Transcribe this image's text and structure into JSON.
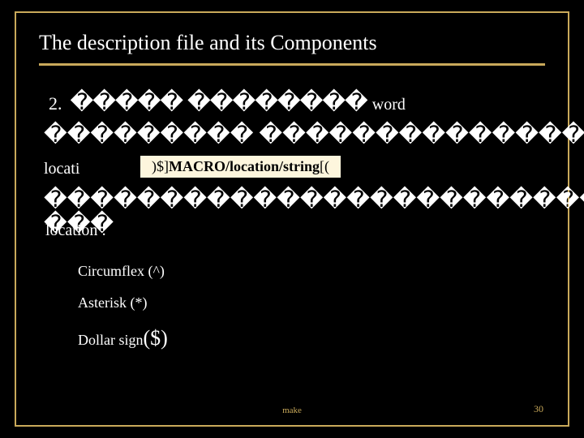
{
  "title": "The description file and its Components",
  "item_number": "2.",
  "boxes_a": "����� ��������",
  "word_label": "word",
  "boxes_row2": "��������� ���������������������������",
  "location_text": "locati",
  "callout_plain1": ")$]",
  "callout_bold": "MACRO/location/string",
  "callout_plain2": "[(",
  "boxes_row3": "����������������������������������",
  "boxes_row3b": "���",
  "overlap_text": "location :",
  "list": {
    "circumflex": "Circumflex (^)",
    "asterisk": "Asterisk (*)",
    "dollar_prefix": "Dollar sign",
    "dollar_symbol": "($)"
  },
  "footer_tool": "make",
  "page_number": "30"
}
